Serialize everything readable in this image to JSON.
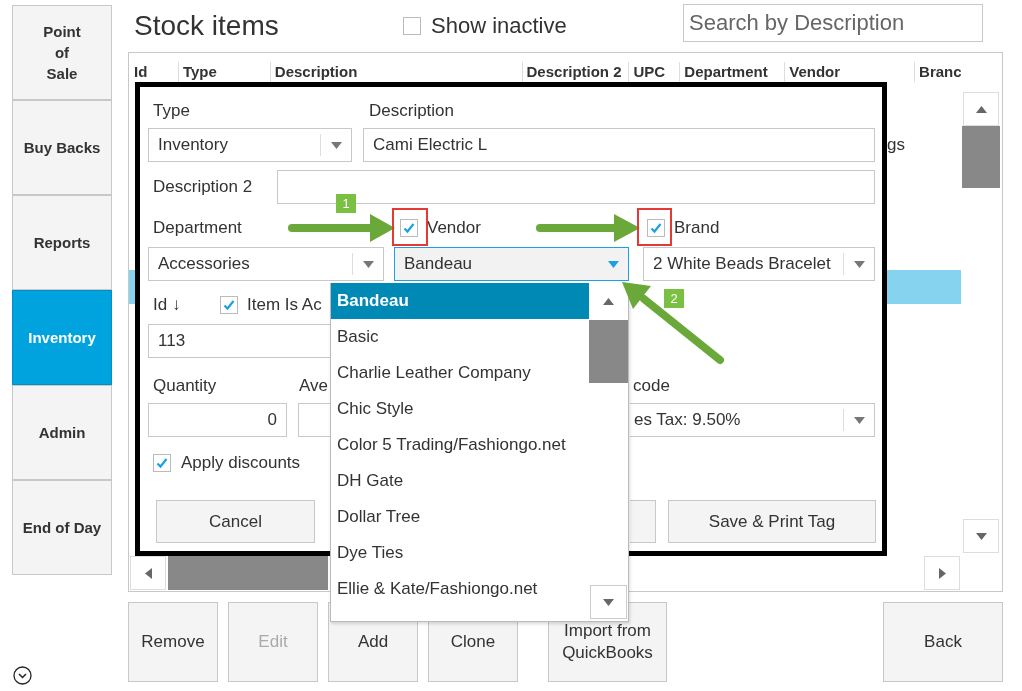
{
  "sidebar": {
    "items": [
      {
        "label": "Point\nof\nSale",
        "selected": false
      },
      {
        "label": "Buy Backs",
        "selected": false
      },
      {
        "label": "Reports",
        "selected": false
      },
      {
        "label": "Inventory",
        "selected": true
      },
      {
        "label": "Admin",
        "selected": false
      },
      {
        "label": "End of Day",
        "selected": false
      }
    ]
  },
  "header": {
    "title": "Stock items",
    "show_inactive": {
      "label": "Show inactive",
      "checked": false
    },
    "search": {
      "placeholder": "Search by Description"
    }
  },
  "table": {
    "columns": [
      "Id",
      "Type",
      "Description",
      "Description 2",
      "UPC",
      "Department",
      "Vendor",
      "Branc"
    ],
    "rows": [
      {
        "vendor": "gs",
        "selected": false
      },
      {
        "selected": true
      }
    ]
  },
  "dialog": {
    "type": {
      "label": "Type",
      "value": "Inventory"
    },
    "description": {
      "label": "Description",
      "value": "Cami Electric L"
    },
    "description_2": {
      "label": "Description 2"
    },
    "department": {
      "label": "Department",
      "value": "Accessories"
    },
    "vendor": {
      "label": "Vendor",
      "checked": true,
      "value": "Bandeau",
      "focused": true
    },
    "brand": {
      "label": "Brand",
      "checked": true,
      "value": "2 White Beads Bracelet"
    },
    "id": {
      "label": "Id ↓",
      "value": "113"
    },
    "item_is_active": {
      "label": "Item Is Ac",
      "checked": true
    },
    "quantity": {
      "label": "Quantity",
      "value": "0"
    },
    "average": {
      "label": "Ave"
    },
    "tax_code": {
      "label": "code",
      "value": "es Tax: 9.50%"
    },
    "apply_discounts": {
      "label": "Apply discounts",
      "checked": true
    },
    "buttons": [
      "Cancel",
      "Save & Print Tag"
    ]
  },
  "vendor_dropdown": {
    "items": [
      {
        "label": "Bandeau",
        "selected": true
      },
      {
        "label": "Basic",
        "selected": false
      },
      {
        "label": "Charlie Leather Company",
        "selected": false
      },
      {
        "label": "Chic Style",
        "selected": false
      },
      {
        "label": "Color 5 Trading/Fashiongo.net",
        "selected": false
      },
      {
        "label": "DH Gate",
        "selected": false
      },
      {
        "label": "Dollar Tree",
        "selected": false
      },
      {
        "label": "Dye Ties",
        "selected": false
      },
      {
        "label": "Ellie & Kate/Fashiongo.net",
        "selected": false
      }
    ]
  },
  "footer": {
    "buttons": [
      {
        "label": "Remove",
        "disabled": false
      },
      {
        "label": "Edit",
        "disabled": true
      },
      {
        "label": "Add",
        "disabled": false
      },
      {
        "label": "Clone",
        "disabled": false
      },
      {
        "label": "Import from QuickBooks",
        "disabled": false
      },
      {
        "label": "Back",
        "disabled": false
      }
    ]
  },
  "annotations": {
    "badges": [
      "1",
      "2"
    ]
  }
}
